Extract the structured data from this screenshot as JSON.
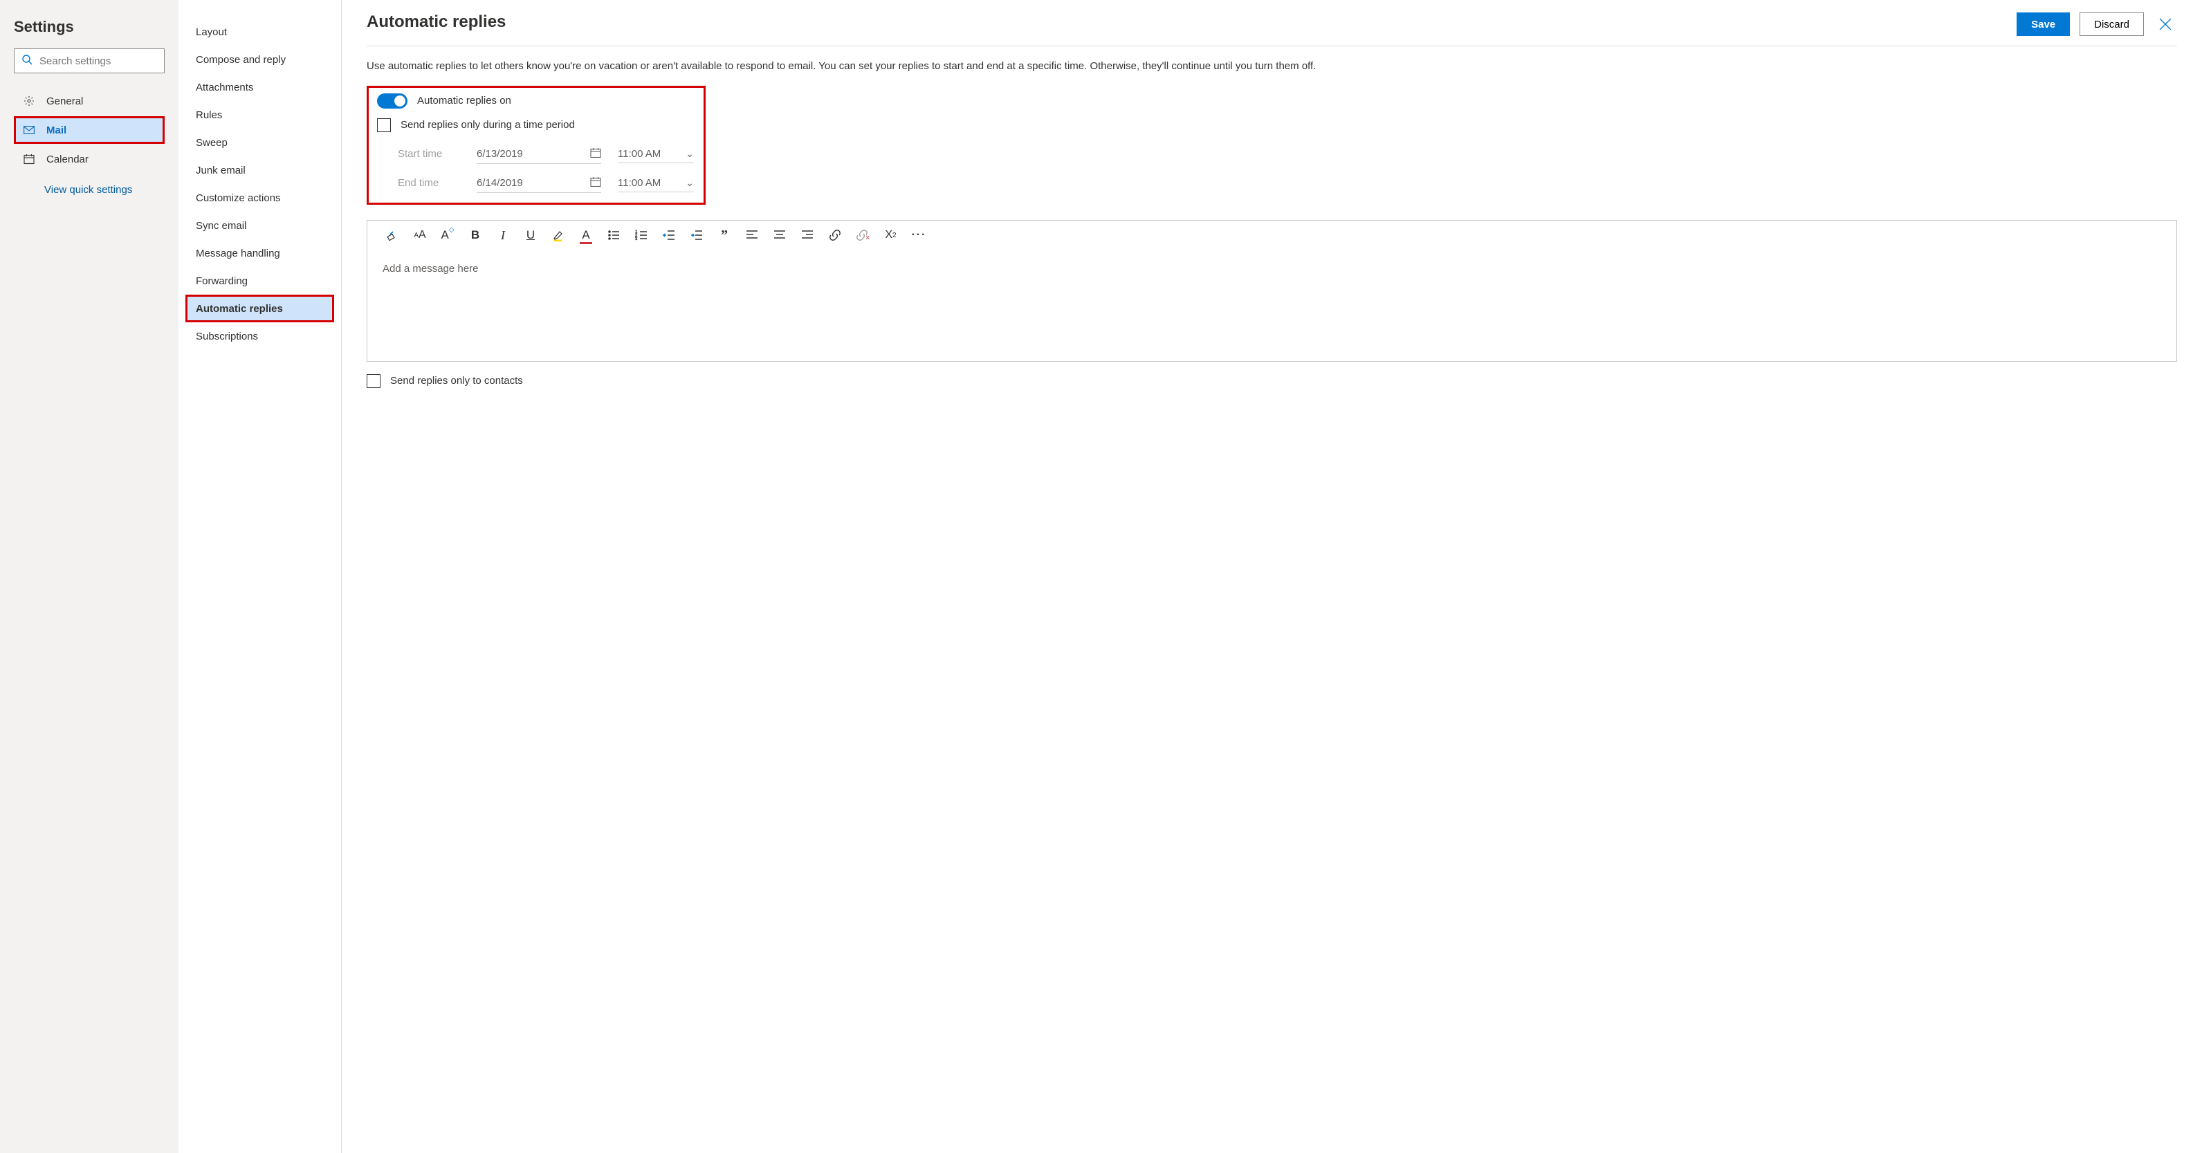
{
  "sidebar": {
    "title": "Settings",
    "search_placeholder": "Search settings",
    "categories": [
      {
        "label": "General"
      },
      {
        "label": "Mail",
        "selected": true
      },
      {
        "label": "Calendar"
      }
    ],
    "quick_link": "View quick settings"
  },
  "subnav": [
    {
      "label": "Layout"
    },
    {
      "label": "Compose and reply"
    },
    {
      "label": "Attachments"
    },
    {
      "label": "Rules"
    },
    {
      "label": "Sweep"
    },
    {
      "label": "Junk email"
    },
    {
      "label": "Customize actions"
    },
    {
      "label": "Sync email"
    },
    {
      "label": "Message handling"
    },
    {
      "label": "Forwarding"
    },
    {
      "label": "Automatic replies",
      "selected": true
    },
    {
      "label": "Subscriptions"
    }
  ],
  "main": {
    "title": "Automatic replies",
    "save_label": "Save",
    "discard_label": "Discard",
    "description": "Use automatic replies to let others know you're on vacation or aren't available to respond to email. You can set your replies to start and end at a specific time. Otherwise, they'll continue until you turn them off.",
    "toggle_label": "Automatic replies on",
    "period_checkbox_label": "Send replies only during a time period",
    "start_label": "Start time",
    "start_date": "6/13/2019",
    "start_time": "11:00 AM",
    "end_label": "End time",
    "end_date": "6/14/2019",
    "end_time": "11:00 AM",
    "editor_placeholder": "Add a message here",
    "contacts_checkbox_label": "Send replies only to contacts"
  }
}
